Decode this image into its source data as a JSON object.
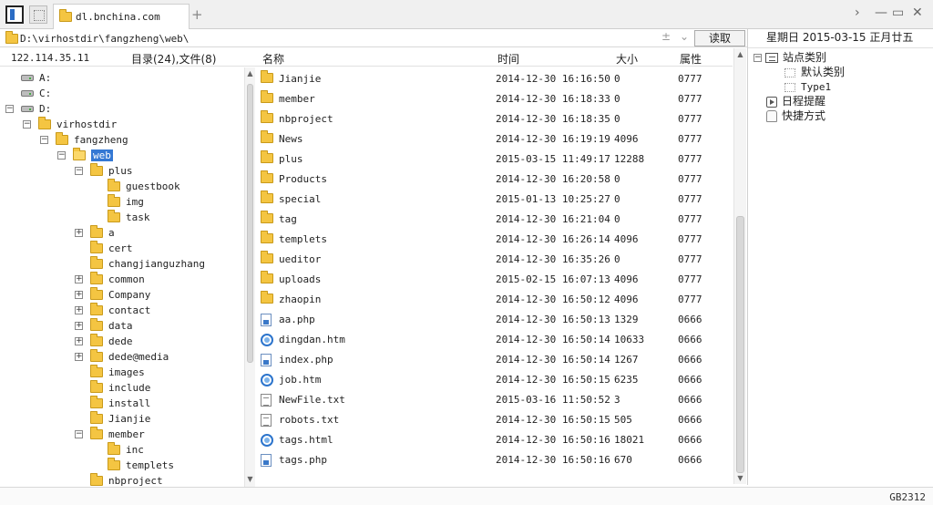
{
  "tab": {
    "label": "dl.bnchina.com"
  },
  "pathbar": {
    "path": "D:\\virhostdir\\fangzheng\\web\\",
    "adjust_glyph": "±",
    "dropdown_glyph": "⌄",
    "read_label": "读取"
  },
  "tree_header": {
    "ip": "122.114.35.11",
    "counts": "目录(24),文件(8)"
  },
  "tree": [
    {
      "label": "A:",
      "icon": "drive",
      "exp": "",
      "indent": 0
    },
    {
      "label": "C:",
      "icon": "drive",
      "exp": "",
      "indent": 0
    },
    {
      "label": "D:",
      "icon": "drive",
      "exp": "−",
      "indent": 0
    },
    {
      "label": "virhostdir",
      "icon": "folder",
      "exp": "−",
      "indent": 1
    },
    {
      "label": "fangzheng",
      "icon": "folder",
      "exp": "−",
      "indent": 2
    },
    {
      "label": "web",
      "icon": "folder-open",
      "exp": "−",
      "indent": 3,
      "selected": true
    },
    {
      "label": "plus",
      "icon": "folder",
      "exp": "−",
      "indent": 4
    },
    {
      "label": "guestbook",
      "icon": "folder",
      "exp": "",
      "indent": 5
    },
    {
      "label": "img",
      "icon": "folder",
      "exp": "",
      "indent": 5
    },
    {
      "label": "task",
      "icon": "folder",
      "exp": "",
      "indent": 5
    },
    {
      "label": "a",
      "icon": "folder",
      "exp": "+",
      "indent": 4
    },
    {
      "label": "cert",
      "icon": "folder",
      "exp": "",
      "indent": 4
    },
    {
      "label": "changjianguzhang",
      "icon": "folder",
      "exp": "",
      "indent": 4
    },
    {
      "label": "common",
      "icon": "folder",
      "exp": "+",
      "indent": 4
    },
    {
      "label": "Company",
      "icon": "folder",
      "exp": "+",
      "indent": 4
    },
    {
      "label": "contact",
      "icon": "folder",
      "exp": "+",
      "indent": 4
    },
    {
      "label": "data",
      "icon": "folder",
      "exp": "+",
      "indent": 4
    },
    {
      "label": "dede",
      "icon": "folder",
      "exp": "+",
      "indent": 4
    },
    {
      "label": "dede@media",
      "icon": "folder",
      "exp": "+",
      "indent": 4
    },
    {
      "label": "images",
      "icon": "folder",
      "exp": "",
      "indent": 4
    },
    {
      "label": "include",
      "icon": "folder",
      "exp": "",
      "indent": 4
    },
    {
      "label": "install",
      "icon": "folder",
      "exp": "",
      "indent": 4
    },
    {
      "label": "Jianjie",
      "icon": "folder",
      "exp": "",
      "indent": 4
    },
    {
      "label": "member",
      "icon": "folder",
      "exp": "−",
      "indent": 4
    },
    {
      "label": "inc",
      "icon": "folder",
      "exp": "",
      "indent": 5
    },
    {
      "label": "templets",
      "icon": "folder",
      "exp": "",
      "indent": 5
    },
    {
      "label": "nbproject",
      "icon": "folder",
      "exp": "",
      "indent": 4
    }
  ],
  "file_header": {
    "name": "名称",
    "time": "时间",
    "size": "大小",
    "attr": "属性"
  },
  "files": [
    {
      "name": "Jianjie",
      "icon": "folder",
      "time": "2014-12-30 16:16:50",
      "size": "0",
      "attr": "0777"
    },
    {
      "name": "member",
      "icon": "folder",
      "time": "2014-12-30 16:18:33",
      "size": "0",
      "attr": "0777"
    },
    {
      "name": "nbproject",
      "icon": "folder",
      "time": "2014-12-30 16:18:35",
      "size": "0",
      "attr": "0777"
    },
    {
      "name": "News",
      "icon": "folder",
      "time": "2014-12-30 16:19:19",
      "size": "4096",
      "attr": "0777"
    },
    {
      "name": "plus",
      "icon": "folder",
      "time": "2015-03-15 11:49:17",
      "size": "12288",
      "attr": "0777"
    },
    {
      "name": "Products",
      "icon": "folder",
      "time": "2014-12-30 16:20:58",
      "size": "0",
      "attr": "0777"
    },
    {
      "name": "special",
      "icon": "folder",
      "time": "2015-01-13 10:25:27",
      "size": "0",
      "attr": "0777"
    },
    {
      "name": "tag",
      "icon": "folder",
      "time": "2014-12-30 16:21:04",
      "size": "0",
      "attr": "0777"
    },
    {
      "name": "templets",
      "icon": "folder",
      "time": "2014-12-30 16:26:14",
      "size": "4096",
      "attr": "0777"
    },
    {
      "name": "ueditor",
      "icon": "folder",
      "time": "2014-12-30 16:35:26",
      "size": "0",
      "attr": "0777"
    },
    {
      "name": "uploads",
      "icon": "folder",
      "time": "2015-02-15 16:07:13",
      "size": "4096",
      "attr": "0777"
    },
    {
      "name": "zhaopin",
      "icon": "folder",
      "time": "2014-12-30 16:50:12",
      "size": "4096",
      "attr": "0777"
    },
    {
      "name": "aa.php",
      "icon": "doc",
      "time": "2014-12-30 16:50:13",
      "size": "1329",
      "attr": "0666"
    },
    {
      "name": "dingdan.htm",
      "icon": "web",
      "time": "2014-12-30 16:50:14",
      "size": "10633",
      "attr": "0666"
    },
    {
      "name": "index.php",
      "icon": "doc",
      "time": "2014-12-30 16:50:14",
      "size": "1267",
      "attr": "0666"
    },
    {
      "name": "job.htm",
      "icon": "web",
      "time": "2014-12-30 16:50:15",
      "size": "6235",
      "attr": "0666"
    },
    {
      "name": "NewFile.txt",
      "icon": "txt",
      "time": "2015-03-16 11:50:52",
      "size": "3",
      "attr": "0666"
    },
    {
      "name": "robots.txt",
      "icon": "txt",
      "time": "2014-12-30 16:50:15",
      "size": "505",
      "attr": "0666"
    },
    {
      "name": "tags.html",
      "icon": "web",
      "time": "2014-12-30 16:50:16",
      "size": "18021",
      "attr": "0666"
    },
    {
      "name": "tags.php",
      "icon": "doc",
      "time": "2014-12-30 16:50:16",
      "size": "670",
      "attr": "0666"
    }
  ],
  "right_panel": {
    "date_line": "星期日 2015-03-15 正月廿五",
    "site_category": "站点类别",
    "default_category": "默认类别",
    "type1": "Type1",
    "schedule": "日程提醒",
    "shortcut": "快捷方式"
  },
  "status": {
    "encoding": "GB2312"
  },
  "colors": {
    "selection": "#3478d4",
    "folder": "#f4c542",
    "link_blue": "#2c74cc"
  }
}
